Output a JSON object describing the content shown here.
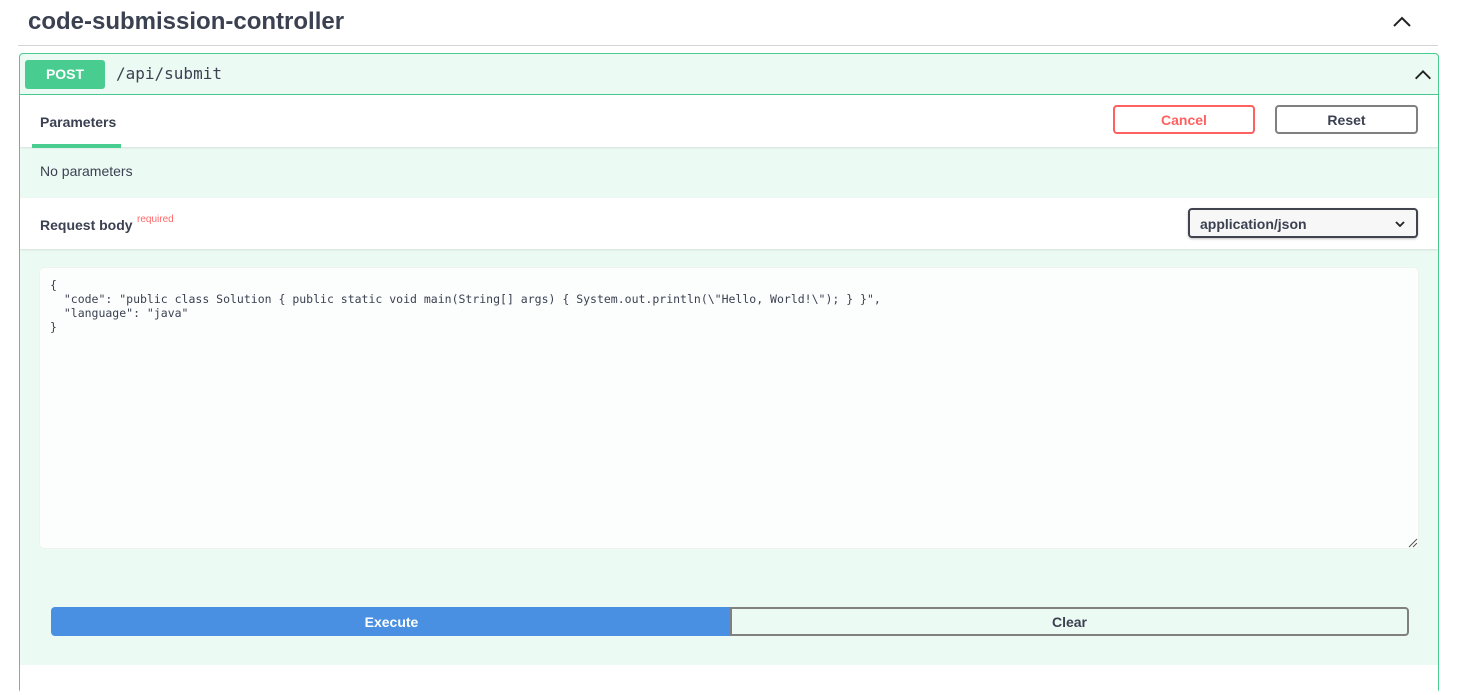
{
  "tag": {
    "title": "code-submission-controller"
  },
  "operation": {
    "method": "POST",
    "path": "/api/submit",
    "method_color": "#49cc90"
  },
  "tabs": {
    "parameters_label": "Parameters"
  },
  "actions": {
    "cancel_label": "Cancel",
    "reset_label": "Reset"
  },
  "parameters": {
    "empty_text": "No parameters"
  },
  "request_body": {
    "title": "Request body",
    "required_label": "required",
    "content_type": "application/json",
    "value": "{\n  \"code\": \"public class Solution { public static void main(String[] args) { System.out.println(\\\"Hello, World!\\\"); } }\",\n  \"language\": \"java\"\n}"
  },
  "buttons": {
    "execute_label": "Execute",
    "clear_label": "Clear"
  },
  "colors": {
    "accent": "#49cc90",
    "execute": "#4990e2",
    "cancel": "#ff6060"
  }
}
